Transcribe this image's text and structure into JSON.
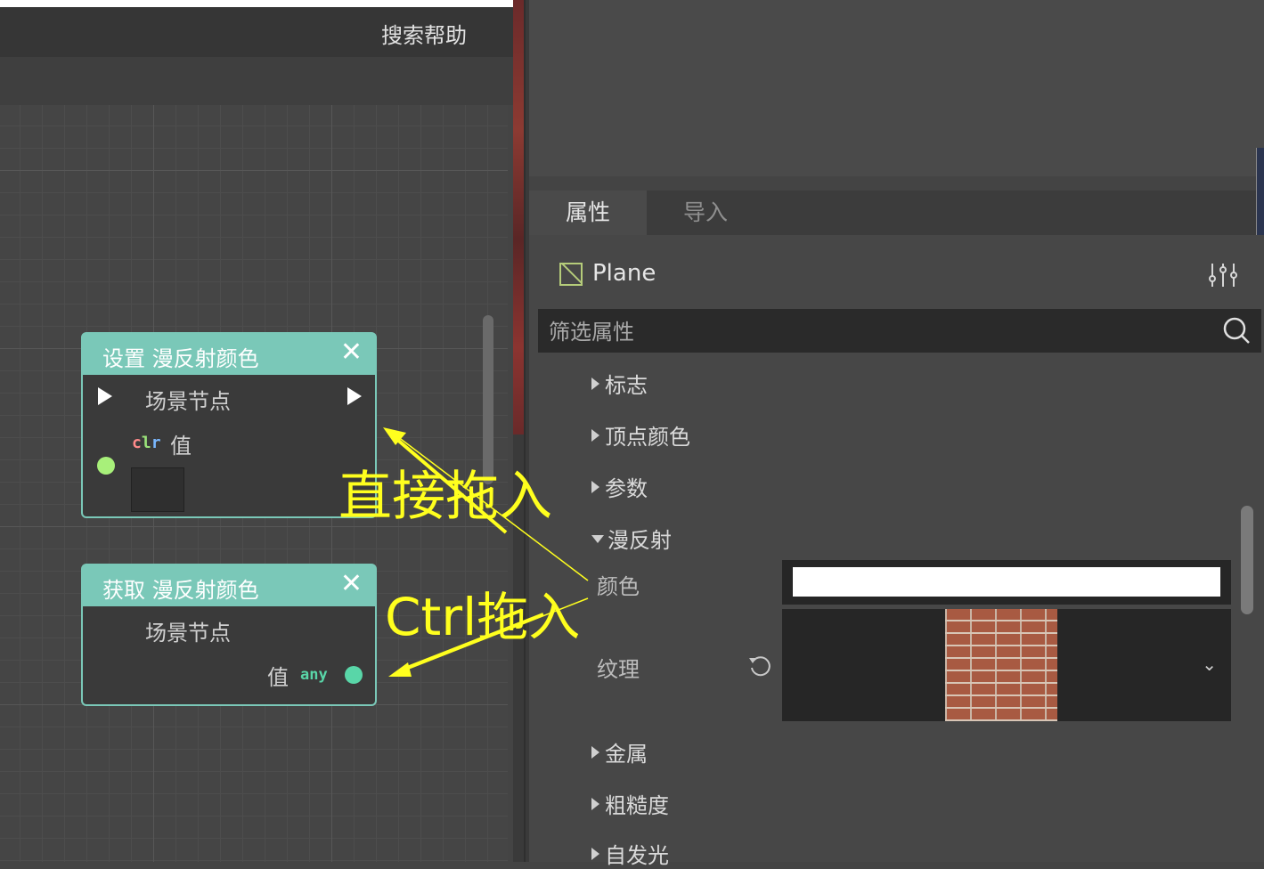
{
  "menu": {
    "help_search": "搜索帮助"
  },
  "nodes": {
    "set": {
      "title": "设置 漫反射颜色",
      "close": "✕",
      "scene_node": "场景节点",
      "value_label": "值",
      "type_tag": "clr",
      "color": "#7ac8b8"
    },
    "get": {
      "title": "获取 漫反射颜色",
      "close": "✕",
      "scene_node": "场景节点",
      "value_label": "值",
      "type_tag": "any"
    }
  },
  "inspector": {
    "tabs": [
      {
        "label": "属性",
        "active": true
      },
      {
        "label": "导入",
        "active": false
      }
    ],
    "object": {
      "name": "Plane",
      "icon": "plane-icon"
    },
    "filter": {
      "placeholder": "筛选属性"
    },
    "sections_before": [
      "标志",
      "顶点颜色",
      "参数"
    ],
    "expanded_section": "漫反射",
    "props": {
      "color_label": "颜色",
      "color_value": "#ffffff",
      "texture_label": "纹理",
      "texture_name": "brick-wall-texture"
    },
    "sections_after": [
      "金属",
      "粗糙度",
      "自发光"
    ]
  },
  "annotations": {
    "drag_direct": "直接拖入",
    "drag_ctrl": "Ctrl拖入",
    "color": "#ffff1e"
  }
}
